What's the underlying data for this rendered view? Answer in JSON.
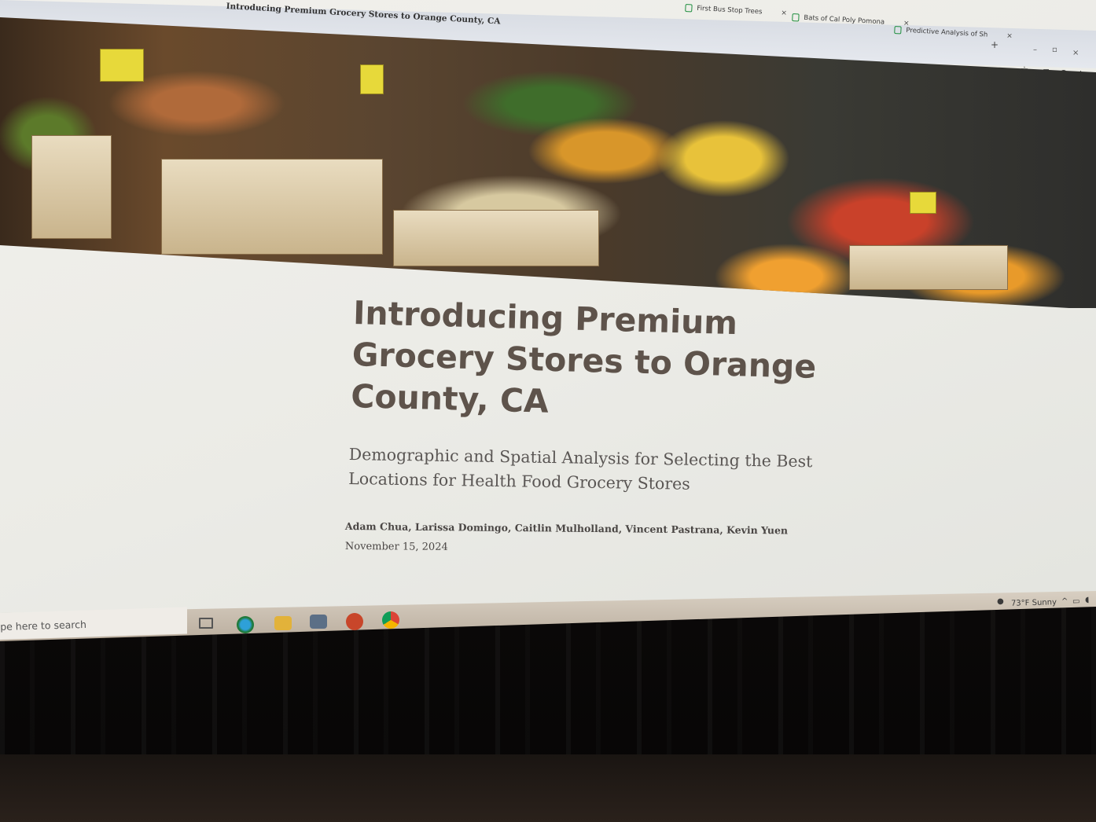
{
  "browser": {
    "window_title": "Introducing Premium Grocery Stores to Orange County, CA",
    "tabs": [
      {
        "label": "First Bus Stop Trees"
      },
      {
        "label": "Bats of Cal Poly Pomona"
      },
      {
        "label": "Predictive Analysis of Sh"
      }
    ],
    "new_tab": "+",
    "window_controls": {
      "minimize": "–",
      "maximize": "▫",
      "close": "×"
    }
  },
  "slide": {
    "title": "Introducing Premium Grocery Stores to Orange County, CA",
    "subtitle": "Demographic and Spatial Analysis for Selecting the Best Locations for Health Food Grocery Stores",
    "authors": "Adam Chua, Larissa Domingo, Caitlin Mulholland, Vincent Pastrana, Kevin Yuen",
    "date": "November 15, 2024"
  },
  "taskbar": {
    "search_placeholder": "pe here to search",
    "apps": [
      "task-view",
      "edge",
      "file-explorer",
      "store",
      "powerpoint",
      "chrome"
    ],
    "weather": "73°F Sunny"
  },
  "colors": {
    "title": "#5e534b",
    "subtitle": "#5a5654",
    "sheets_icon": "#1e8e3e"
  }
}
